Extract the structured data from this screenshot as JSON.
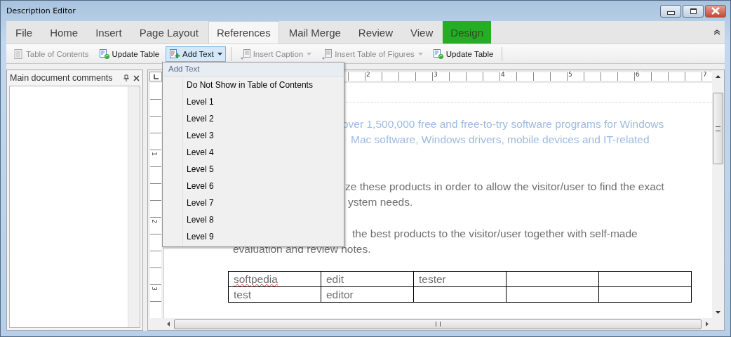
{
  "window": {
    "title": "Description Editor"
  },
  "tabs": [
    {
      "label": "File",
      "selected": false,
      "kind": "standard"
    },
    {
      "label": "Home",
      "selected": false,
      "kind": "standard"
    },
    {
      "label": "Insert",
      "selected": false,
      "kind": "standard"
    },
    {
      "label": "Page Layout",
      "selected": false,
      "kind": "standard"
    },
    {
      "label": "References",
      "selected": true,
      "kind": "standard"
    },
    {
      "label": "Mail Merge",
      "selected": false,
      "kind": "standard"
    },
    {
      "label": "Review",
      "selected": false,
      "kind": "standard"
    },
    {
      "label": "View",
      "selected": false,
      "kind": "standard"
    },
    {
      "label": "Design",
      "selected": false,
      "kind": "contextual"
    }
  ],
  "toolbar": [
    {
      "label": "Table of Contents",
      "kind": "toc",
      "disabled": true,
      "dropdown": false,
      "expanded": false
    },
    {
      "label": "Update Table",
      "kind": "update",
      "disabled": false,
      "dropdown": false,
      "expanded": false
    },
    {
      "label": "Add Text",
      "kind": "add",
      "disabled": false,
      "dropdown": true,
      "expanded": true
    },
    {
      "label": "Insert Caption",
      "kind": "caption",
      "disabled": true,
      "dropdown": true,
      "expanded": false
    },
    {
      "label": "Insert Table of Figures",
      "kind": "caption",
      "disabled": true,
      "dropdown": true,
      "expanded": false
    },
    {
      "label": "Update Table",
      "kind": "update",
      "disabled": false,
      "dropdown": false,
      "expanded": false
    }
  ],
  "side_panel": {
    "title": "Main document comments"
  },
  "horizontal_ruler": {
    "labels": [
      "2",
      "3",
      "4",
      "5",
      "6",
      "7"
    ]
  },
  "vertical_ruler": {
    "labels": [
      "1",
      "2",
      "3"
    ]
  },
  "document": {
    "paragraphs": [
      {
        "kind": "accent",
        "lines": [
          "over 1,500,000 free and free-to-try software programs for Windows",
          "Mac software, Windows drivers, mobile devices and IT-related"
        ]
      },
      {
        "kind": "body",
        "lines": [
          "ze these products in order to allow the visitor/user to find the exact",
          "ystem needs."
        ]
      },
      {
        "kind": "body",
        "lines": [
          "the best products to the visitor/user together with self-made",
          "evaluation and review notes."
        ]
      }
    ],
    "table": {
      "rows": [
        {
          "cells": [
            {
              "text": "softpedia",
              "misspelled": true
            },
            {
              "text": "edit",
              "misspelled": false
            },
            {
              "text": "tester",
              "misspelled": false
            }
          ]
        },
        {
          "cells": [
            {
              "text": "test",
              "misspelled": false
            },
            {
              "text": "editor",
              "misspelled": false
            }
          ]
        }
      ]
    }
  },
  "menu": {
    "header": "Add Text",
    "items": [
      "Do Not Show in Table of Contents",
      "Level 1",
      "Level 2",
      "Level 3",
      "Level 4",
      "Level 5",
      "Level 6",
      "Level 7",
      "Level 8",
      "Level 9"
    ]
  }
}
